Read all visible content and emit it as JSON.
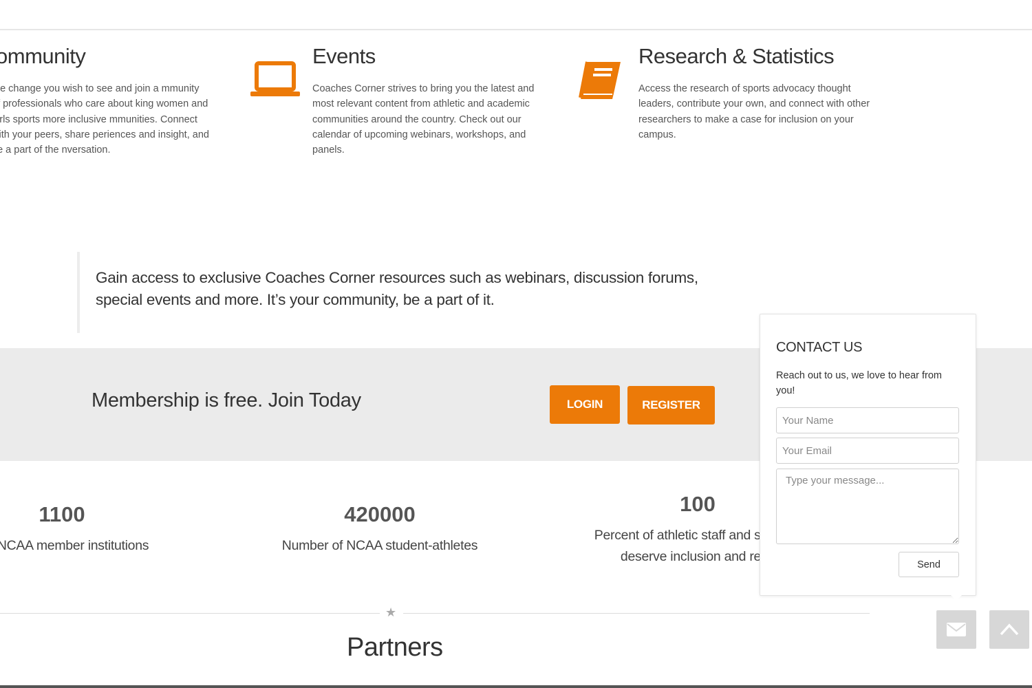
{
  "features": [
    {
      "icon": "community-icon",
      "title": "ommunity",
      "text": "the change you wish to see and join a mmunity of professionals who care about king women and girls sports more inclusive mmunities. Connect with your peers, share periences and insight, and be a part of the nversation."
    },
    {
      "icon": "laptop-icon",
      "title": "Events",
      "text": "Coaches Corner strives to bring you the latest and most relevant content from athletic and academic communities around the country. Check out our calendar of upcoming webinars, workshops, and panels."
    },
    {
      "icon": "book-icon",
      "title": "Research & Statistics",
      "text": "Access the research of sports advocacy thought leaders, contribute your own, and connect with other researchers to make a case for inclusion on your campus."
    }
  ],
  "quote": "Gain access to exclusive Coaches Corner resources such as webinars, discussion forums, special events and more. It’s your community, be a part of it.",
  "membership": {
    "text": "Membership is free. Join Today",
    "login_label": "LOGIN",
    "register_label": "REGISTER"
  },
  "stats": [
    {
      "value": "1100",
      "label_line1": "r of NCAA member institutions",
      "label_line2": ""
    },
    {
      "value": "420000",
      "label_line1": "Number of NCAA student-athletes",
      "label_line2": ""
    },
    {
      "value": "100",
      "label_line1": "Percent of athletic staff and student-",
      "label_line2": "deserve inclusion and resp"
    }
  ],
  "partners_title": "Partners",
  "contact": {
    "title": "CONTACT US",
    "subtitle": "Reach out to us, we love to hear from you!",
    "name_placeholder": "Your Name",
    "email_placeholder": "Your Email",
    "message_placeholder": "Type your message...",
    "send_label": "Send"
  },
  "floating": {
    "mail_icon": "envelope-icon",
    "top_icon": "chevron-up-icon"
  },
  "colors": {
    "accent": "#ec7a08",
    "band_bg": "#ebebeb",
    "fab_bg": "#d7d7d7"
  }
}
